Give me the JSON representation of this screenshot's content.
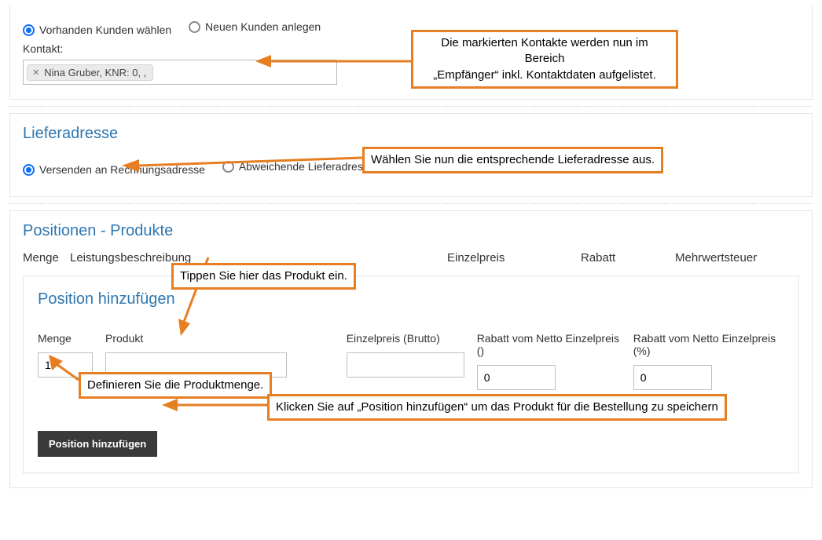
{
  "recipient": {
    "radio_existing_label": "Vorhanden Kunden wählen",
    "radio_new_label": "Neuen Kunden anlegen",
    "contact_label": "Kontakt:",
    "chip_label": "Nina Gruber, KNR: 0, ,"
  },
  "delivery": {
    "title": "Lieferadresse",
    "radio_billing_label": "Versenden an Rechnungsadresse",
    "radio_other_label": "Abweichende Lieferadresse"
  },
  "positions": {
    "title": "Positionen - Produkte",
    "col_qty": "Menge",
    "col_desc": "Leistungsbeschreibung",
    "col_unit": "Einzelpreis",
    "col_discount": "Rabatt",
    "col_vat": "Mehrwertsteuer"
  },
  "add_position": {
    "title": "Position hinzufügen",
    "qty_label": "Menge",
    "qty_value": "1",
    "product_label": "Produkt",
    "product_value": "",
    "unitprice_label": "Einzelpreis (Brutto)",
    "unitprice_value": "",
    "discount_abs_label": "Rabatt vom Netto Einzelpreis ()",
    "discount_abs_value": "0",
    "discount_pct_label": "Rabatt vom Netto Einzelpreis (%)",
    "discount_pct_value": "0",
    "submit_label": "Position hinzufügen"
  },
  "annotations": {
    "a1": "Die markierten Kontakte werden nun im Bereich\n„Empfänger“ inkl. Kontaktdaten aufgelistet.",
    "a2": "Wählen Sie nun die entsprechende Lieferadresse aus.",
    "a3": "Tippen Sie hier das Produkt ein.",
    "a4": "Definieren Sie die Produktmenge.",
    "a5": "Klicken Sie auf „Position hinzufügen“ um das Produkt für die Bestellung zu speichern"
  }
}
